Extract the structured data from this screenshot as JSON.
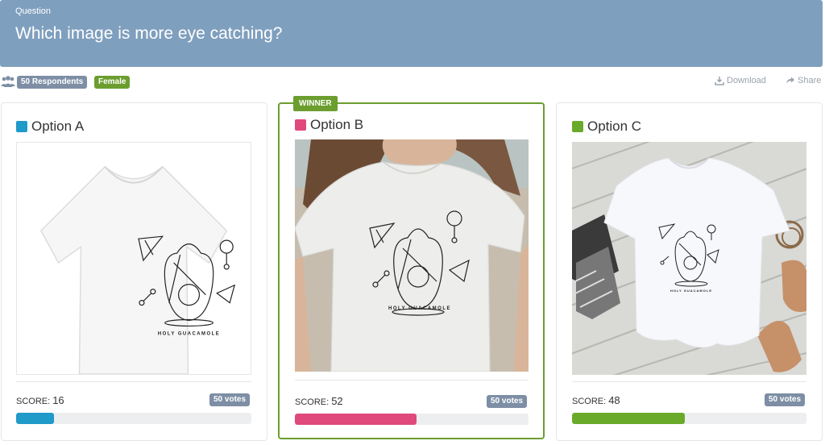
{
  "question": {
    "label": "Question",
    "title": "Which image is more eye catching?"
  },
  "meta": {
    "respondents": "50 Respondents",
    "filter_badge": "Female",
    "download_label": "Download",
    "share_label": "Share"
  },
  "winner_label": "WINNER",
  "options": [
    {
      "title": "Option A",
      "color": "#1f9ac9",
      "score_label": "SCORE:",
      "score": "16",
      "score_value": 16,
      "votes": "50 votes",
      "is_winner": false,
      "image": "white t-shirt flat lay on white background with avocado line-art print"
    },
    {
      "title": "Option B",
      "color": "#e0497b",
      "score_label": "SCORE:",
      "score": "52",
      "score_value": 52,
      "votes": "50 votes",
      "is_winner": true,
      "image": "woman wearing white t-shirt with avocado line-art print"
    },
    {
      "title": "Option C",
      "color": "#6aaa2a",
      "score_label": "SCORE:",
      "score": "48",
      "score_value": 48,
      "votes": "50 votes",
      "is_winner": false,
      "image": "white t-shirt on white wooden boards with sandals and accessories"
    }
  ],
  "print_text": "HOLY GUACAMOLE"
}
